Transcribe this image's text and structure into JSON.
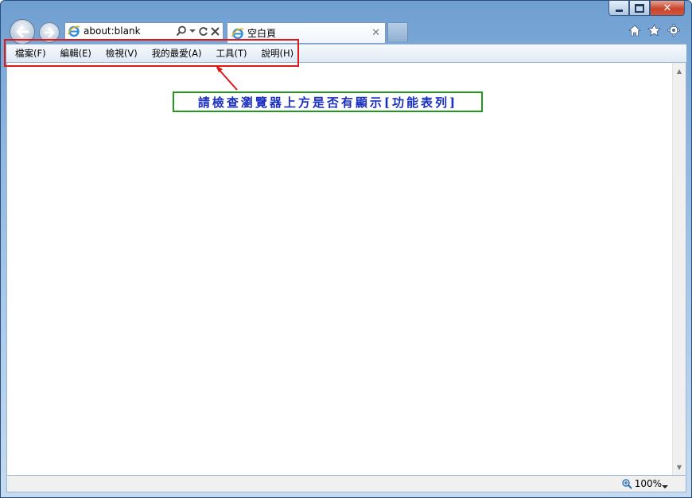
{
  "address": {
    "url": "about:blank"
  },
  "tab": {
    "title": "空白頁"
  },
  "menu": [
    {
      "label": "檔案(F)"
    },
    {
      "label": "編輯(E)"
    },
    {
      "label": "檢視(V)"
    },
    {
      "label": "我的最愛(A)"
    },
    {
      "label": "工具(T)"
    },
    {
      "label": "說明(H)"
    }
  ],
  "annotation": {
    "text": "請檢查瀏覽器上方是否有顯示[功能表列]"
  },
  "status": {
    "zoom": "100%"
  },
  "icons": {
    "back": "back-arrow-icon",
    "forward": "forward-arrow-icon",
    "ie": "ie-logo-icon",
    "search": "search-icon",
    "refresh": "refresh-icon",
    "stop": "stop-icon",
    "home": "home-icon",
    "favorites": "star-icon",
    "tools": "gear-icon",
    "zoom": "zoom-icon"
  },
  "colors": {
    "highlight": "#e01818",
    "callout_border": "#1f9a1f",
    "callout_text": "#1a2fc0",
    "close_button": "#c7452b"
  }
}
